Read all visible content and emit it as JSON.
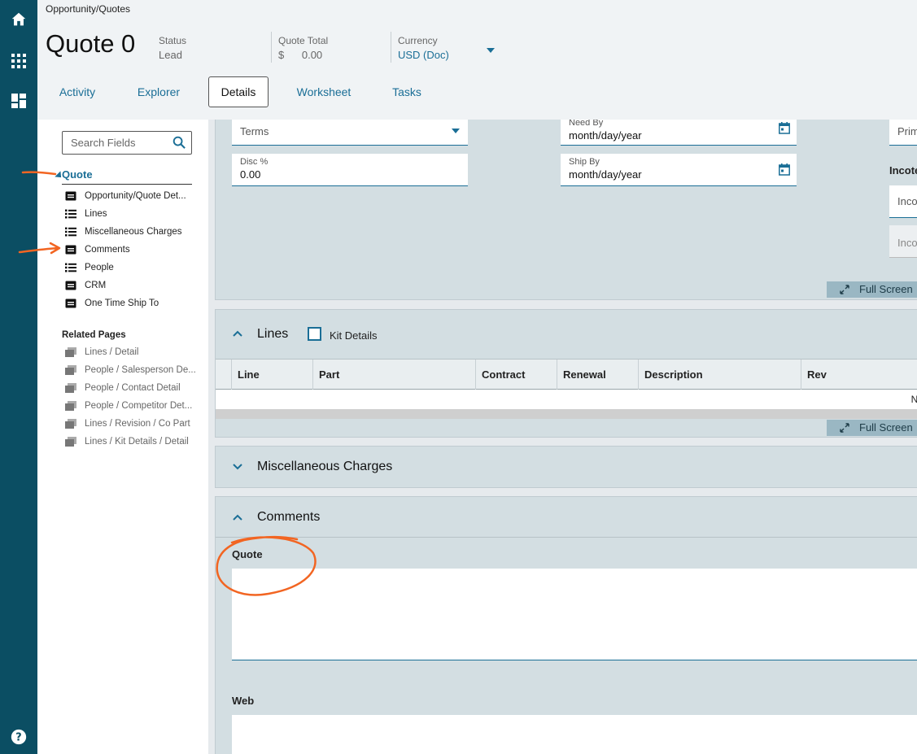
{
  "header": {
    "breadcrumb": "Opportunity/Quotes",
    "title": "Quote 0",
    "status_label": "Status",
    "status_value": "Lead",
    "total_label": "Quote Total",
    "total_symbol": "$",
    "total_value": "0.00",
    "currency_label": "Currency",
    "currency_value": "USD (Doc)",
    "tabs": [
      {
        "label": "Activity",
        "active": false
      },
      {
        "label": "Explorer",
        "active": false
      },
      {
        "label": "Details",
        "active": true
      },
      {
        "label": "Worksheet",
        "active": false
      },
      {
        "label": "Tasks",
        "active": false
      }
    ]
  },
  "rail": {
    "icons": [
      "home-icon",
      "apps-grid-icon",
      "dashboard-icon",
      "help-icon"
    ]
  },
  "nav": {
    "search_placeholder": "Search Fields",
    "section": "Quote",
    "items": [
      {
        "label": "Opportunity/Quote Det...",
        "icon": "card-icon"
      },
      {
        "label": "Lines",
        "icon": "list-icon"
      },
      {
        "label": "Miscellaneous Charges",
        "icon": "list-icon"
      },
      {
        "label": "Comments",
        "icon": "card-icon"
      },
      {
        "label": "People",
        "icon": "list-icon"
      },
      {
        "label": "CRM",
        "icon": "card-icon"
      },
      {
        "label": "One Time Ship To",
        "icon": "card-icon"
      }
    ],
    "related_title": "Related Pages",
    "related": [
      "Lines / Detail",
      "People / Salesperson De...",
      "People / Contact Detail",
      "People / Competitor Det...",
      "Lines / Revision / Co Part",
      "Lines / Kit Details / Detail"
    ]
  },
  "details": {
    "terms_placeholder": "Terms",
    "disc_label": "Disc %",
    "disc_value": "0.00",
    "need_by_label": "Need By",
    "need_by_value": "month/day/year",
    "ship_by_label": "Ship By",
    "ship_by_value": "month/day/year",
    "prim_partial": "Prim",
    "incoterms_partial": "Incote",
    "inco_partial_1": "Inco",
    "inco_partial_2": "Inco",
    "fullscreen": "Full Screen"
  },
  "lines": {
    "title": "Lines",
    "kit_details": "Kit Details",
    "columns": [
      "Line",
      "Part",
      "Contract",
      "Renewal",
      "Description",
      "Rev"
    ],
    "no_data_partial": "No",
    "fullscreen": "Full Screen"
  },
  "misc": {
    "title": "Miscellaneous Charges"
  },
  "comments": {
    "title": "Comments",
    "quote_label": "Quote",
    "web_label": "Web"
  },
  "colors": {
    "rail": "#0b4e63",
    "accent": "#1a6e96",
    "annotation": "#f26522"
  }
}
